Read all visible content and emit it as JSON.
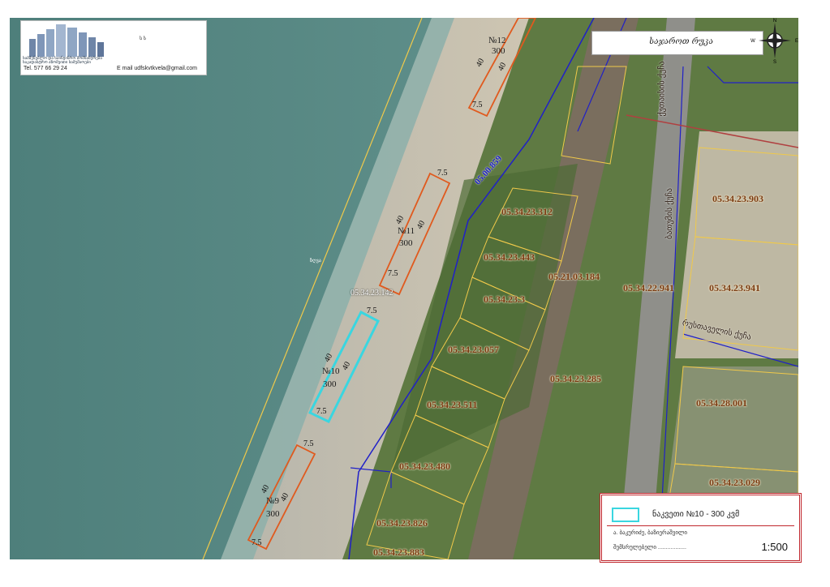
{
  "map": {
    "title": "საჯაროთ რუკა",
    "scale": "1:500",
    "compass": {
      "n": "N",
      "s": "S",
      "e": "E",
      "w": "W"
    },
    "water_note": "ზღვა",
    "colors": {
      "parcel_line": "#f0c94a",
      "cadastral_line": "#2020c8",
      "plot_outline": "#e05a1e",
      "highlight": "#3ad6e0",
      "legend_border": "#c0272d"
    }
  },
  "company": {
    "name_line1": "სამშენებლო და საინჟინრო მომსახურება",
    "name_line2": "საკადასტრო აზომვითი სამუშაოები",
    "mini": "ს ს",
    "phone": "Tel.  577 66 29 24",
    "email_label": "E mail",
    "email": "udfskvtkvela@gmail.com"
  },
  "plots": [
    {
      "id": "p12",
      "number": "№12",
      "area": "300",
      "len": "40",
      "width": "7.5"
    },
    {
      "id": "p11",
      "number": "№11",
      "area": "300",
      "len": "40",
      "width": "7.5"
    },
    {
      "id": "p10",
      "number": "№10",
      "area": "300",
      "len": "40",
      "width": "7.5"
    },
    {
      "id": "p9",
      "number": "№9",
      "area": "300",
      "len": "40",
      "width": "7.5"
    }
  ],
  "parcels": [
    "05.34.23.312",
    "05.34.23.443",
    "05.34.23.3",
    "05.34.23.057",
    "05.34.23.511",
    "05.34.23.480",
    "05.34.23.826",
    "05.34.23.883",
    "05.34.23.285",
    "05.34.23.903",
    "05.34.23.941",
    "05.34.22.941",
    "05.21.03.184",
    "05.34.28.001",
    "05.34.23.029",
    "05.34.23.142",
    "05.00.859"
  ],
  "roads": [
    "ქუთაისის ქუჩა",
    "ბათუმის ქუჩა",
    "რუსთაველის ქუჩა"
  ],
  "legend": {
    "plot_text": "ნაკვეთი №10 - 300  კვმ",
    "owner_line": "ა. ბაკურიძე, ბაზიერაშვილი",
    "prepared_line": "შემსრულებელი ..................",
    "scale": "1:500"
  }
}
